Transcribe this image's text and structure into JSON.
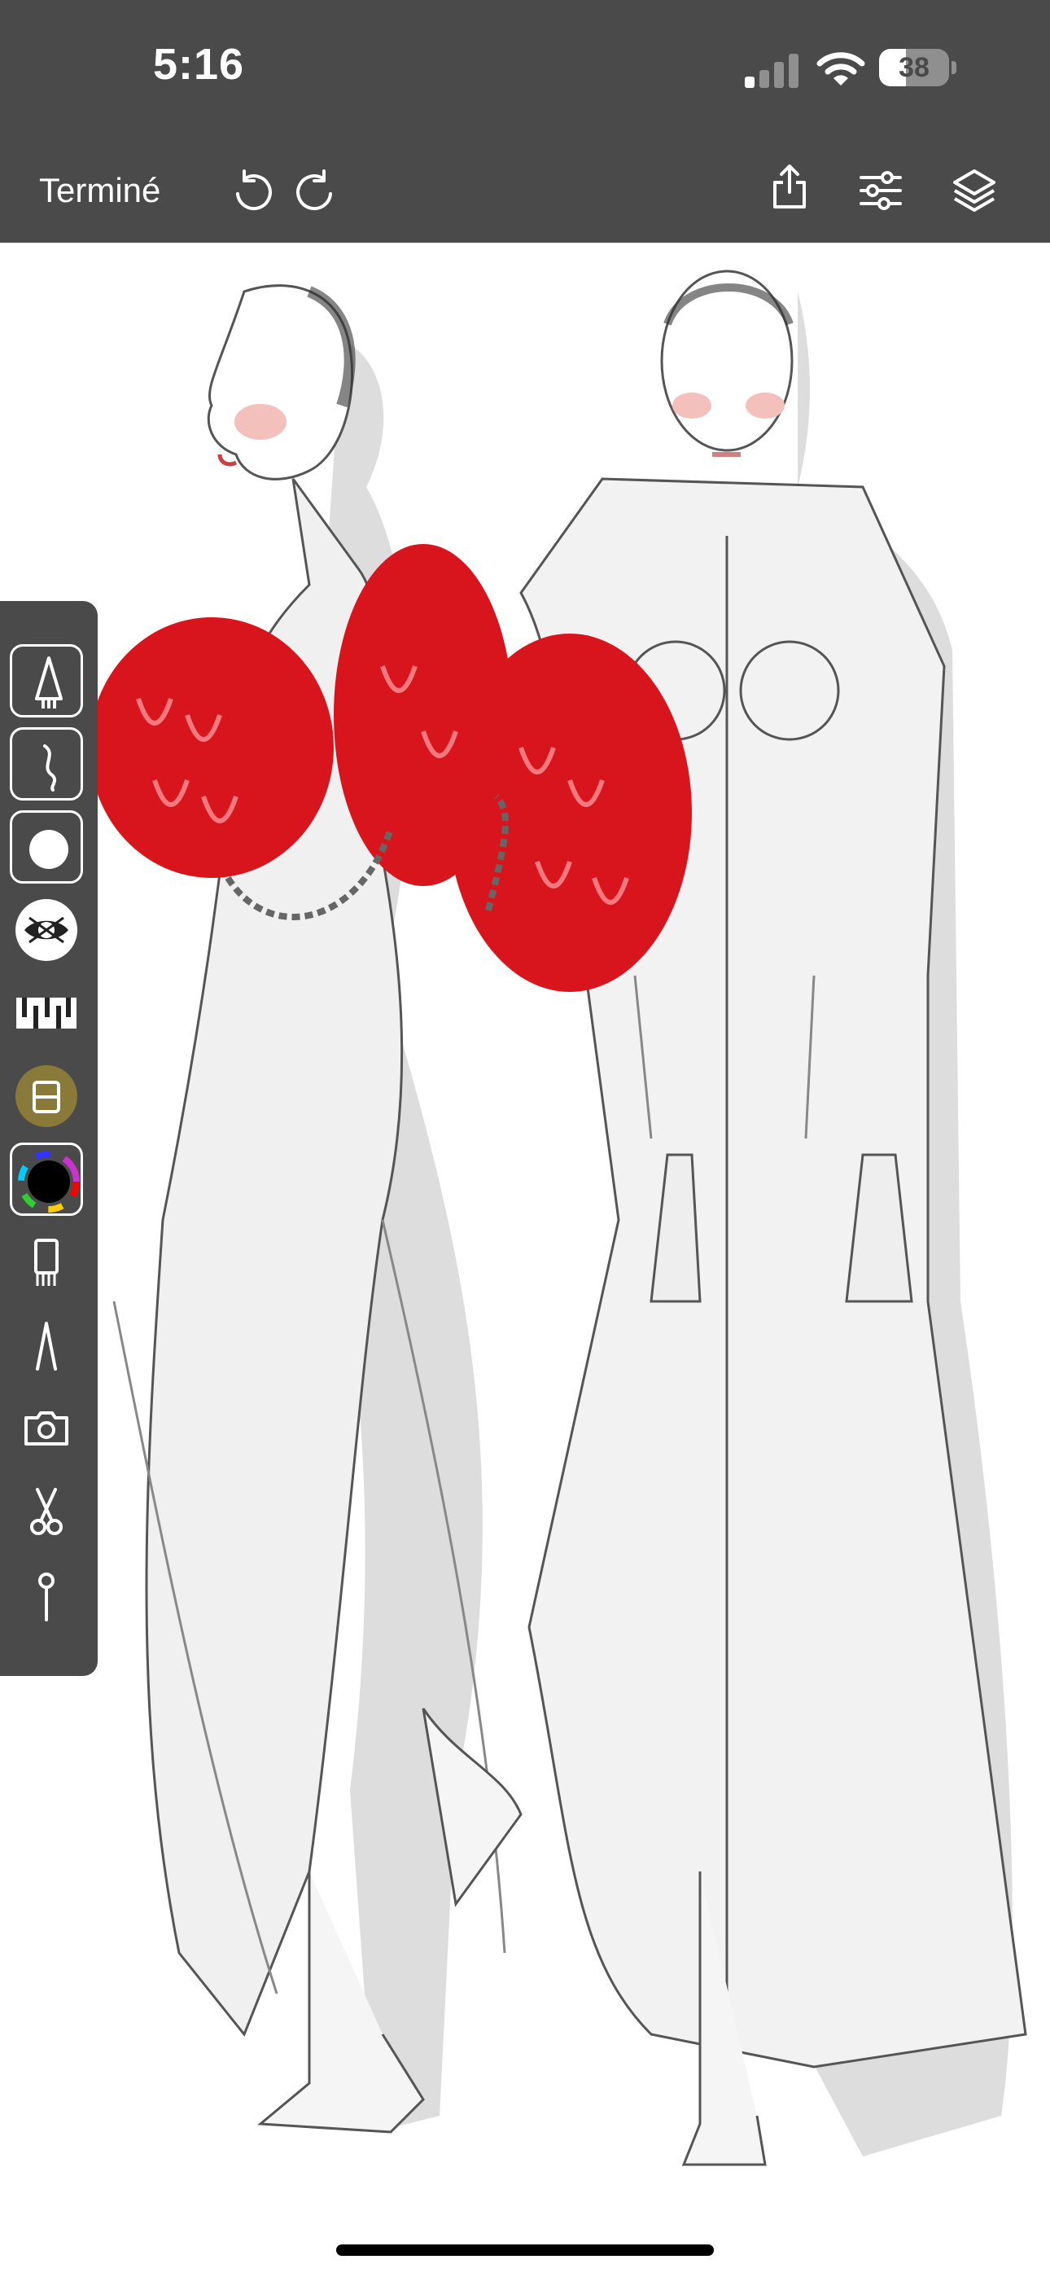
{
  "status": {
    "time": "5:16",
    "battery_level": "38",
    "battery_fraction": 0.38
  },
  "toolbar": {
    "done_label": "Terminé",
    "icons": [
      "undo-icon",
      "redo-icon",
      "share-icon",
      "adjustments-icon",
      "layers-icon"
    ]
  },
  "sidebar": {
    "tools": [
      "pen-nib-icon",
      "stroke-icon",
      "brush-dot-icon",
      "texture-brush-icon",
      "pattern-brush-icon",
      "fill-brush-icon",
      "color-wheel-icon",
      "ruler-icon",
      "shape-icon",
      "camera-icon",
      "scissors-icon",
      "pin-icon"
    ]
  },
  "canvas": {
    "content": "fashion-sketch",
    "accent_color": "#d8151d"
  },
  "colors": {
    "chrome": "#4a4a4a",
    "accent_red": "#d8151d",
    "icon": "#ffffff"
  }
}
